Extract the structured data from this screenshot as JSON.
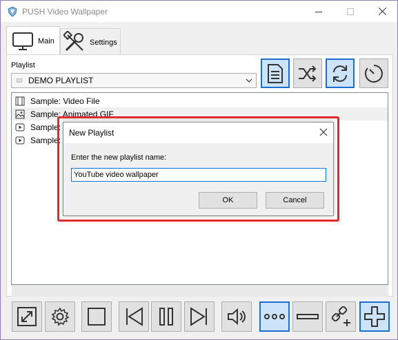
{
  "window": {
    "title": "PUSH Video Wallpaper"
  },
  "tabs": [
    {
      "label": "Main",
      "icon": "monitor-icon",
      "selected": true
    },
    {
      "label": "Settings",
      "icon": "tools-icon",
      "selected": false
    }
  ],
  "playlist": {
    "label": "Playlist",
    "selected": "DEMO PLAYLIST"
  },
  "items": [
    {
      "label": "Sample: Video File",
      "icon": "film-icon"
    },
    {
      "label": "Sample: Animated GIF",
      "icon": "image-icon"
    },
    {
      "label": "Sample: Y",
      "icon": "play-icon"
    },
    {
      "label": "Sample: Y",
      "icon": "play-icon"
    }
  ],
  "dialog": {
    "title": "New Playlist",
    "prompt": "Enter the new playlist name:",
    "input_value": "YouTube video wallpaper",
    "ok_label": "OK",
    "cancel_label": "Cancel"
  },
  "colors": {
    "accent": "#1a6fd1",
    "highlight": "#e32929"
  }
}
